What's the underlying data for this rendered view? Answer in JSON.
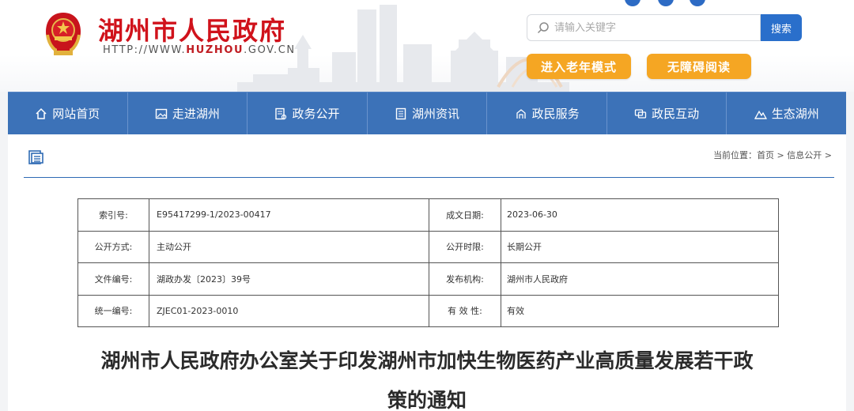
{
  "header": {
    "site_title": "湖州市人民政府",
    "site_url_prefix": "HTTP://WWW.",
    "site_url_domain": "HUZHOU",
    "site_url_suffix": ".GOV.CN",
    "search": {
      "placeholder": "请输入关键字",
      "button_label": "搜索"
    },
    "elderly_mode_label": "进入老年模式",
    "accessible_reading_label": "无障碍阅读",
    "accent_color": "#d0121b",
    "button_color": "#f5a623"
  },
  "nav": {
    "items": [
      {
        "label": "网站首页",
        "icon": "home-icon"
      },
      {
        "label": "走进湖州",
        "icon": "image-icon"
      },
      {
        "label": "政务公开",
        "icon": "document-icon"
      },
      {
        "label": "湖州资讯",
        "icon": "news-icon"
      },
      {
        "label": "政民服务",
        "icon": "service-icon"
      },
      {
        "label": "政民互动",
        "icon": "interaction-icon"
      },
      {
        "label": "生态湖州",
        "icon": "mountain-icon"
      }
    ],
    "background_color": "#3c72b8"
  },
  "breadcrumb": {
    "prefix": "当前位置：",
    "items": [
      "首页",
      "信息公开"
    ],
    "separator": " > "
  },
  "meta_table": {
    "rows": [
      {
        "k1": "索引号:",
        "v1": "E95417299-1/2023-00417",
        "k2": "成文日期:",
        "v2": "2023-06-30"
      },
      {
        "k1": "公开方式:",
        "v1": "主动公开",
        "k2": "公开时限:",
        "v2": "长期公开"
      },
      {
        "k1": "文件编号:",
        "v1": "湖政办发〔2023〕39号",
        "k2": "发布机构:",
        "v2": "湖州市人民政府"
      },
      {
        "k1": "统一编号:",
        "v1": "ZJEC01-2023-0010",
        "k2": "有 效 性:",
        "v2": "有效"
      }
    ]
  },
  "document": {
    "title_line1": "湖州市人民政府办公室关于印发湖州市加快生物医药产业高质量发展若干政",
    "title_line2": "策的通知"
  }
}
